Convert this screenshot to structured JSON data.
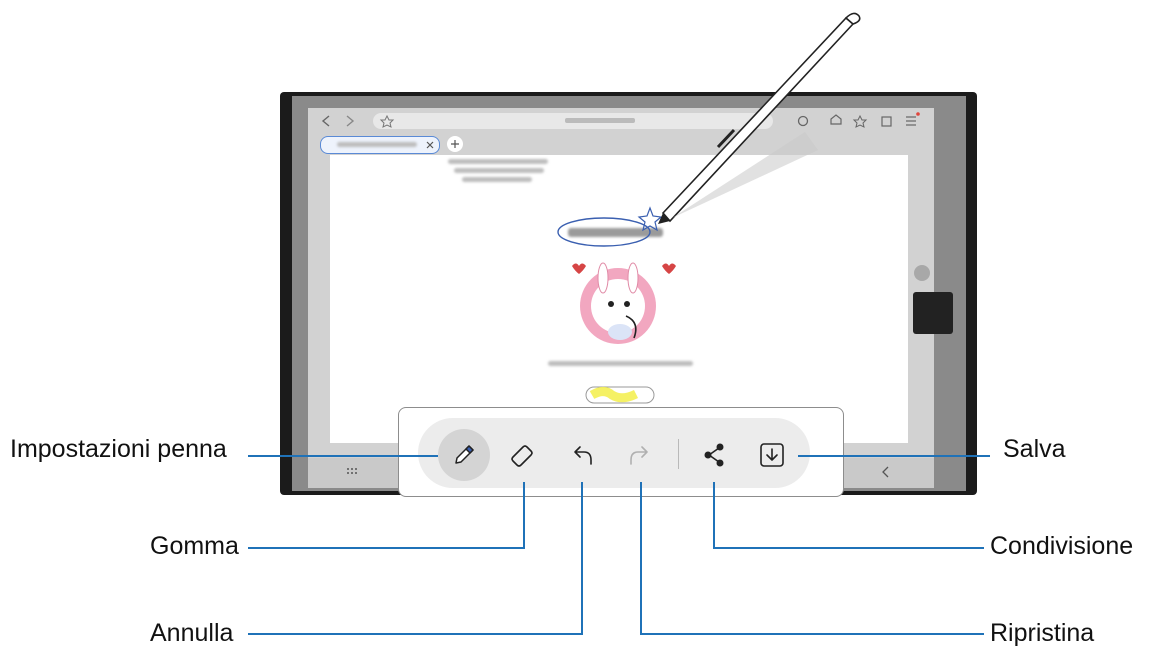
{
  "callouts": {
    "pen_settings": "Impostazioni penna",
    "eraser": "Gomma",
    "undo": "Annulla",
    "save": "Salva",
    "share": "Condivisione",
    "redo": "Ripristina"
  },
  "toolbar": {
    "buttons": [
      {
        "icon": "pen-icon",
        "state": "selected"
      },
      {
        "icon": "eraser-icon"
      },
      {
        "icon": "undo-icon"
      },
      {
        "icon": "redo-icon",
        "state": "disabled"
      },
      {
        "icon": "share-icon"
      },
      {
        "icon": "save-icon"
      }
    ]
  },
  "colors": {
    "callout_line": "#1f72b8",
    "pen_ink": "#3a5fb0",
    "highlighter": "#f3ee4a",
    "sticker_pink": "#f2a7c0",
    "heart": "#d64545"
  }
}
